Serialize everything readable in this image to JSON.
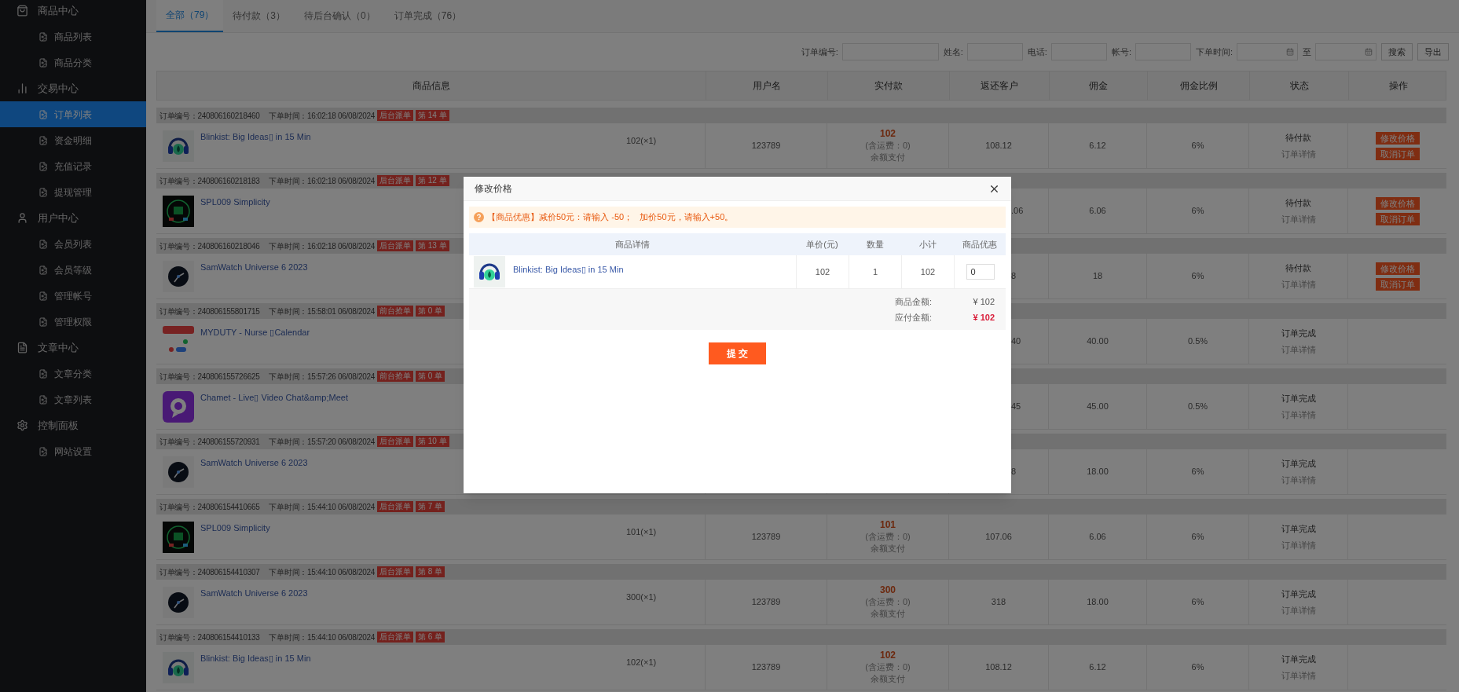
{
  "sidebar": {
    "groups": [
      {
        "label": "商品中心",
        "children": [
          {
            "label": "商品列表",
            "selected": false
          },
          {
            "label": "商品分类",
            "selected": false
          }
        ]
      },
      {
        "label": "交易中心",
        "children": [
          {
            "label": "订单列表",
            "selected": true
          },
          {
            "label": "资金明细",
            "selected": false
          },
          {
            "label": "充值记录",
            "selected": false
          },
          {
            "label": "提现管理",
            "selected": false
          }
        ]
      },
      {
        "label": "用户中心",
        "children": [
          {
            "label": "会员列表",
            "selected": false
          },
          {
            "label": "会员等级",
            "selected": false
          },
          {
            "label": "管理帐号",
            "selected": false
          },
          {
            "label": "管理权限",
            "selected": false
          }
        ]
      },
      {
        "label": "文章中心",
        "children": [
          {
            "label": "文章分类",
            "selected": false
          },
          {
            "label": "文章列表",
            "selected": false
          }
        ]
      },
      {
        "label": "控制面板",
        "children": [
          {
            "label": "网站设置",
            "selected": false
          }
        ]
      }
    ]
  },
  "tabs": [
    {
      "label": "全部（79）",
      "selected": true
    },
    {
      "label": "待付款（3）",
      "selected": false
    },
    {
      "label": "待后台确认（0）",
      "selected": false
    },
    {
      "label": "订单完成（76）",
      "selected": false
    }
  ],
  "filters": {
    "fields": [
      {
        "label": "订单编号:",
        "kind": "text"
      },
      {
        "label": "姓名:",
        "kind": "text"
      },
      {
        "label": "电话:",
        "kind": "text"
      },
      {
        "label": "帐号:",
        "kind": "text"
      },
      {
        "label": "下单时间:",
        "kind": "date"
      },
      {
        "label": "至",
        "kind": "date"
      }
    ],
    "buttons": [
      "搜索",
      "导出"
    ]
  },
  "table": {
    "columns": [
      "商品信息",
      "用户名",
      "实付款",
      "返还客户",
      "佣金",
      "佣金比例",
      "状态",
      "操作"
    ],
    "rows": [
      {
        "order_no": "订单编号：240806160218460",
        "time": "下单时间：16:02:18 06/08/2024",
        "tags": [
          "后台派单",
          "第 14 单"
        ],
        "product": "Blinkist: Big Ideas▯ in 15 Min",
        "kind": "headphones",
        "price": "102(×1)",
        "user": "123789",
        "paid": [
          "102",
          "(含运费：0)",
          "余额支付"
        ],
        "return": "108.12",
        "commission": "6.12",
        "rate": "6%",
        "status": "待付款",
        "detail": "订单详情",
        "actions": [
          "修改价格",
          "取消订单"
        ]
      },
      {
        "order_no": "订单编号：240806160218183",
        "time": "下单时间：16:02:18 06/08/2024",
        "tags": [
          "后台派单",
          "第 12 单"
        ],
        "product": "SPL009 Simplicity",
        "kind": "square-watch",
        "return": ".06",
        "commission": "6.06",
        "rate": "6%",
        "status": "待付款",
        "detail": "订单详情",
        "actions": [
          "修改价格",
          "取消订单"
        ]
      },
      {
        "order_no": "订单编号：240806160218046",
        "time": "下单时间：16:02:18 06/08/2024",
        "tags": [
          "后台派单",
          "第 13 单"
        ],
        "product": "SamWatch Universe 6 2023",
        "kind": "round-watch",
        "return": "8",
        "commission": "18",
        "rate": "6%",
        "status": "待付款",
        "detail": "订单详情",
        "actions": [
          "修改价格",
          "取消订单"
        ]
      },
      {
        "order_no": "订单编号：240806155801715",
        "time": "下单时间：15:58:01 06/08/2024",
        "tags": [
          "前台抢单",
          "第 0 单"
        ],
        "product": "MYDUTY - Nurse ▯Calendar",
        "kind": "calendar",
        "return": "40",
        "commission": "40.00",
        "rate": "0.5%",
        "status": "订单完成",
        "detail": "订单详情"
      },
      {
        "order_no": "订单编号：240806155726625",
        "time": "下单时间：15:57:26 06/08/2024",
        "tags": [
          "前台抢单",
          "第 0 单"
        ],
        "product": "Chamet - Live▯ Video Chat&amp;Meet",
        "kind": "chat",
        "return": "45",
        "commission": "45.00",
        "rate": "0.5%",
        "status": "订单完成",
        "detail": "订单详情"
      },
      {
        "order_no": "订单编号：240806155720931",
        "time": "下单时间：15:57:20 06/08/2024",
        "tags": [
          "后台派单",
          "第 10 单"
        ],
        "product": "SamWatch Universe 6 2023",
        "kind": "round-watch",
        "return": "8",
        "commission": "18.00",
        "rate": "6%",
        "status": "订单完成",
        "detail": "订单详情"
      },
      {
        "order_no": "订单编号：240806154410665",
        "time": "下单时间：15:44:10 06/08/2024",
        "tags": [
          "后台派单",
          "第 7 单"
        ],
        "product": "SPL009 Simplicity",
        "kind": "square-watch",
        "price": "101(×1)",
        "user": "123789",
        "paid": [
          "101",
          "(含运费：0)",
          "余额支付"
        ],
        "return": "107.06",
        "commission": "6.06",
        "rate": "6%",
        "status": "订单完成",
        "detail": "订单详情"
      },
      {
        "order_no": "订单编号：240806154410307",
        "time": "下单时间：15:44:10 06/08/2024",
        "tags": [
          "后台派单",
          "第 8 单"
        ],
        "product": "SamWatch Universe 6 2023",
        "kind": "round-watch",
        "price": "300(×1)",
        "user": "123789",
        "paid": [
          "300",
          "(含运费：0)",
          "余额支付"
        ],
        "return": "318",
        "commission": "18.00",
        "rate": "6%",
        "status": "订单完成",
        "detail": "订单详情"
      },
      {
        "order_no": "订单编号：240806154410133",
        "time": "下单时间：15:44:10 06/08/2024",
        "tags": [
          "后台派单",
          "第 6 单"
        ],
        "product": "Blinkist: Big Ideas▯ in 15 Min",
        "kind": "headphones",
        "price": "102(×1)",
        "user": "123789",
        "paid": [
          "102",
          "(含运费：0)",
          "余额支付"
        ],
        "return": "108.12",
        "commission": "6.12",
        "rate": "6%",
        "status": "订单完成",
        "detail": "订单详情"
      }
    ]
  },
  "modal": {
    "title": "修改价格",
    "notice": "【商品优惠】减价50元：请输入 -50；   加价50元，请输入+50。",
    "columns": [
      "商品详情",
      "单价(元)",
      "数量",
      "小计",
      "商品优惠"
    ],
    "item": {
      "product": "Blinkist: Big Ideas▯ in 15 Min",
      "kind": "headphones",
      "unit_price": "102",
      "quantity": "1",
      "subtotal": "102",
      "discount": "0"
    },
    "summary": [
      {
        "label": "商品金额:",
        "value": "¥ 102",
        "kind": "plain"
      },
      {
        "label": "应付金额:",
        "value": "¥ 102",
        "kind": "total"
      }
    ],
    "submit": "提 交"
  }
}
